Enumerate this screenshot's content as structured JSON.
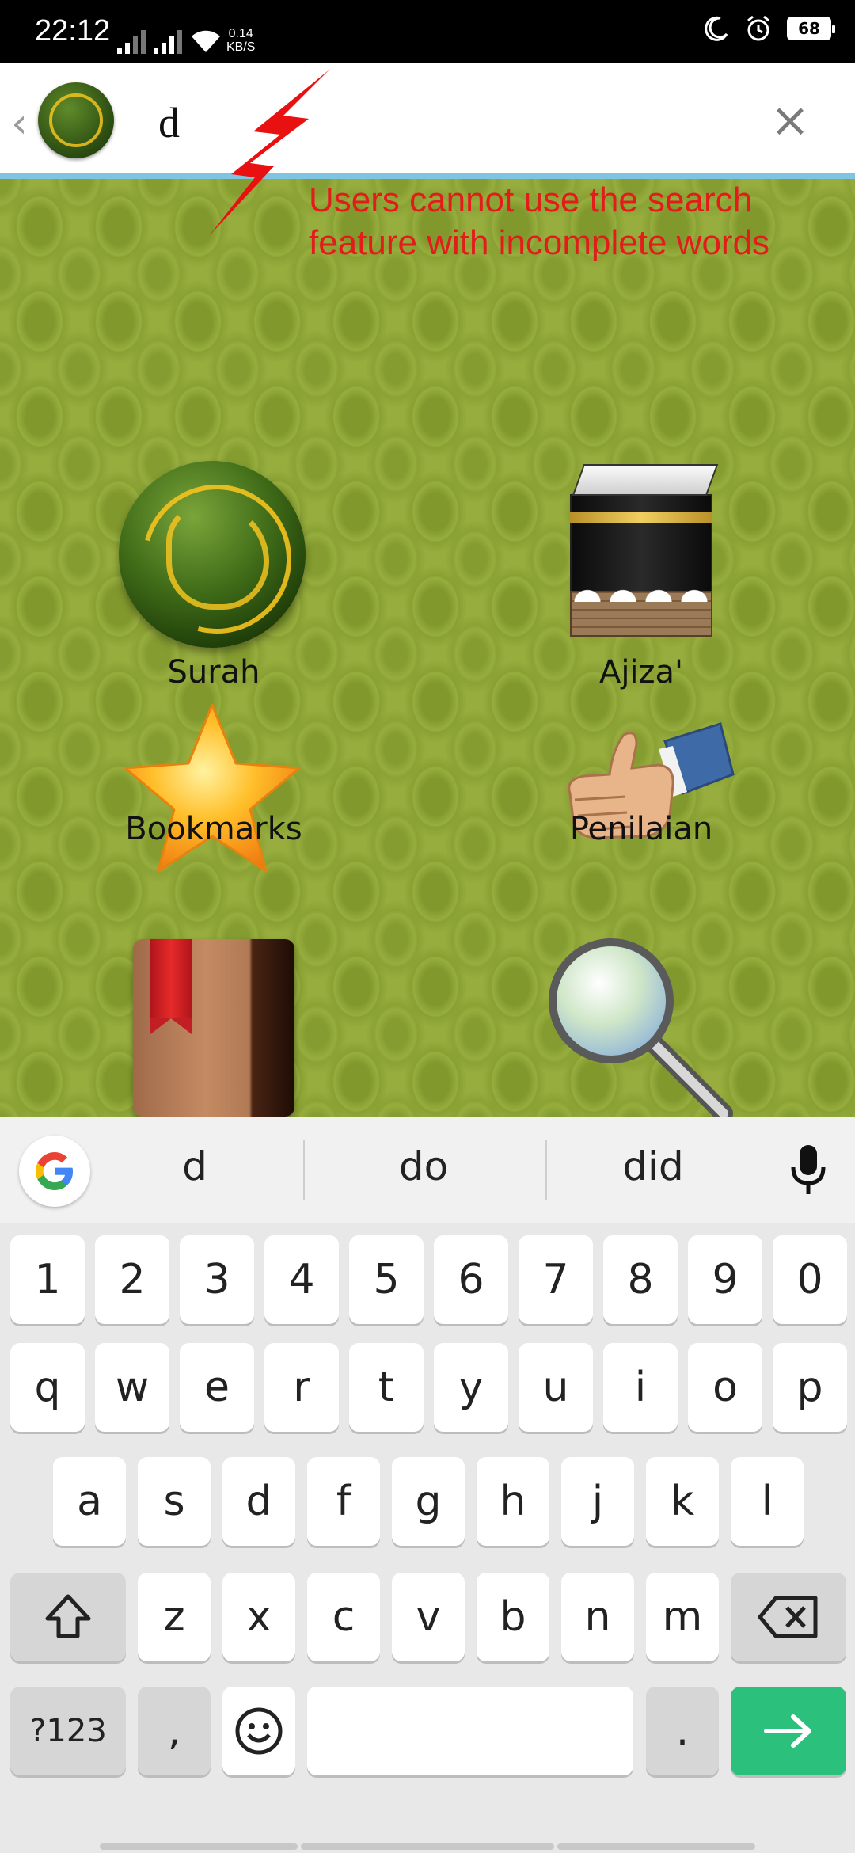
{
  "status_bar": {
    "time": "22:12",
    "net_speed_value": "0.14",
    "net_speed_unit": "KB/S",
    "battery": "68"
  },
  "search": {
    "value": "d",
    "clear_label": "×"
  },
  "annotation": {
    "line1": "Users cannot use the search",
    "line2": "feature with incomplete words",
    "color": "#e21b1b"
  },
  "menu": [
    {
      "label": "Surah",
      "icon": "quran-icon"
    },
    {
      "label": "Ajiza'",
      "icon": "kaaba-icon"
    },
    {
      "label": "Bookmarks",
      "icon": "star-icon"
    },
    {
      "label": "Penilaian",
      "icon": "thumbs-up-icon"
    },
    {
      "label": "",
      "icon": "book-icon"
    },
    {
      "label": "",
      "icon": "magnifier-icon"
    }
  ],
  "keyboard": {
    "suggestions": [
      "d",
      "do",
      "did"
    ],
    "row_numbers": [
      "1",
      "2",
      "3",
      "4",
      "5",
      "6",
      "7",
      "8",
      "9",
      "0"
    ],
    "row_top": [
      "q",
      "w",
      "e",
      "r",
      "t",
      "y",
      "u",
      "i",
      "o",
      "p"
    ],
    "row_mid": [
      "a",
      "s",
      "d",
      "f",
      "g",
      "h",
      "j",
      "k",
      "l"
    ],
    "row_bottom": [
      "z",
      "x",
      "c",
      "v",
      "b",
      "n",
      "m"
    ],
    "symbols_label": "?123",
    "comma_label": ",",
    "period_label": ".",
    "accent_color": "#2bc17c"
  }
}
